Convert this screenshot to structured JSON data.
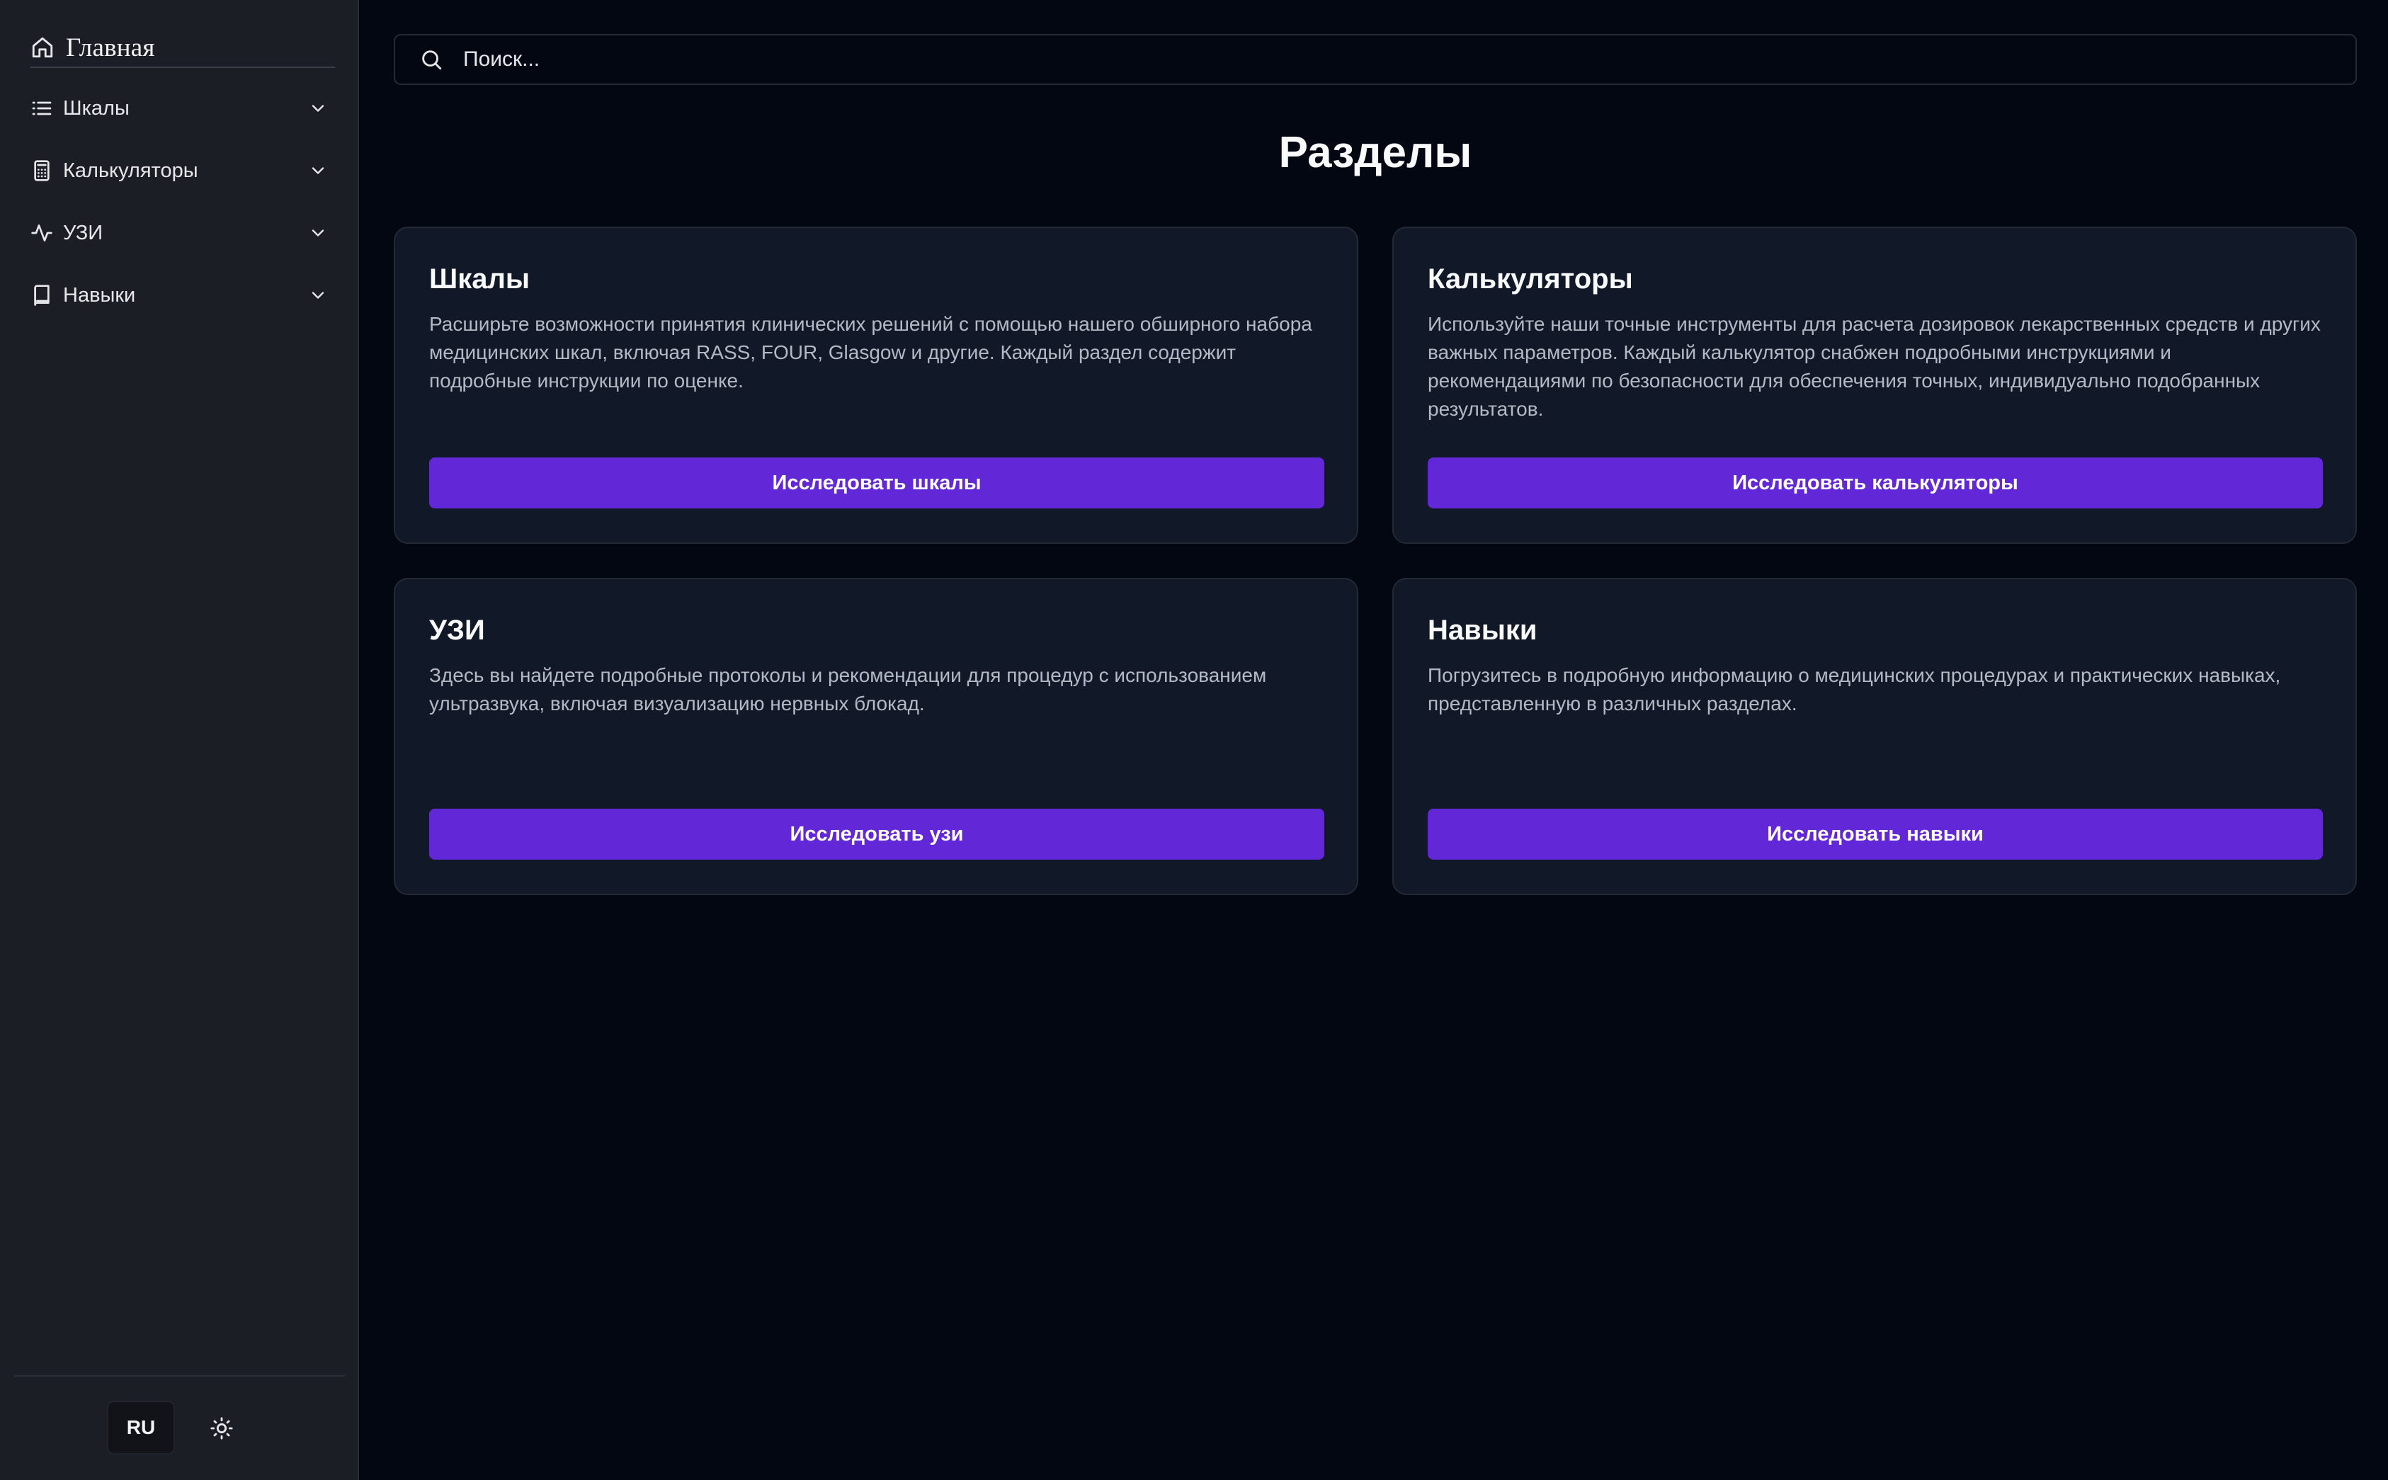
{
  "sidebar": {
    "home": {
      "label": "Главная",
      "icon": "home-icon"
    },
    "items": [
      {
        "label": "Шкалы",
        "icon": "list-icon"
      },
      {
        "label": "Калькуляторы",
        "icon": "calculator-icon"
      },
      {
        "label": "УЗИ",
        "icon": "activity-icon"
      },
      {
        "label": "Навыки",
        "icon": "book-icon"
      }
    ],
    "footer": {
      "language": "RU",
      "theme_icon": "sun-icon"
    }
  },
  "search": {
    "placeholder": "Поиск...",
    "icon": "search-icon"
  },
  "main": {
    "title": "Разделы",
    "cards": [
      {
        "title": "Шкалы",
        "description": "Расширьте возможности принятия клинических решений с помощью нашего обширного набора медицинских шкал, включая RASS, FOUR, Glasgow и другие. Каждый раздел содержит подробные инструкции по оценке.",
        "button": "Исследовать шкалы"
      },
      {
        "title": "Калькуляторы",
        "description": "Используйте наши точные инструменты для расчета дозировок лекарственных средств и других важных параметров. Каждый калькулятор снабжен подробными инструкциями и рекомендациями по безопасности для обеспечения точных, индивидуально подобранных результатов.",
        "button": "Исследовать калькуляторы"
      },
      {
        "title": "УЗИ",
        "description": "Здесь вы найдете подробные протоколы и рекомендации для процедур с использованием ультразвука, включая визуализацию нервных блокад.",
        "button": "Исследовать узи"
      },
      {
        "title": "Навыки",
        "description": "Погрузитесь в подробную информацию о медицинских процедурах и практических навыках, представленную в различных разделах.",
        "button": "Исследовать навыки"
      }
    ]
  },
  "colors": {
    "background": "#030712",
    "sidebar": "#1b1e24",
    "card": "#111827",
    "accent": "#6228d7"
  }
}
